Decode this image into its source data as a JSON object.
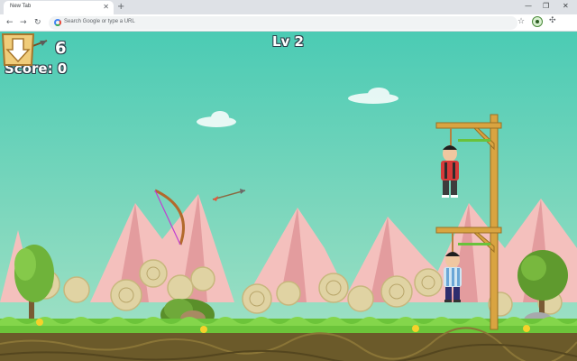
{
  "browser": {
    "tab_title": "New Tab",
    "tab_close": "✕",
    "new_tab": "+",
    "minimize": "—",
    "restore": "❐",
    "close": "✕",
    "back": "←",
    "forward": "→",
    "reload": "↻",
    "omnibox_placeholder": "Search Google or type a URL",
    "star": "☆",
    "puzzle": "✣",
    "menu": "⋮"
  },
  "game": {
    "arrows_left": "6",
    "score_text": "Score: 0",
    "level_text": "Lv 2",
    "colors": {
      "sky_top": "#4bcbb4",
      "mountain": "#f2b5b3",
      "grass": "#6cc43a",
      "soil": "#6b5a2a",
      "gallows": "#d9a441"
    },
    "icons": [
      "arrow-count-icon",
      "menu-down-arrow-icon",
      "bow-icon",
      "arrow-projectile-icon"
    ]
  }
}
